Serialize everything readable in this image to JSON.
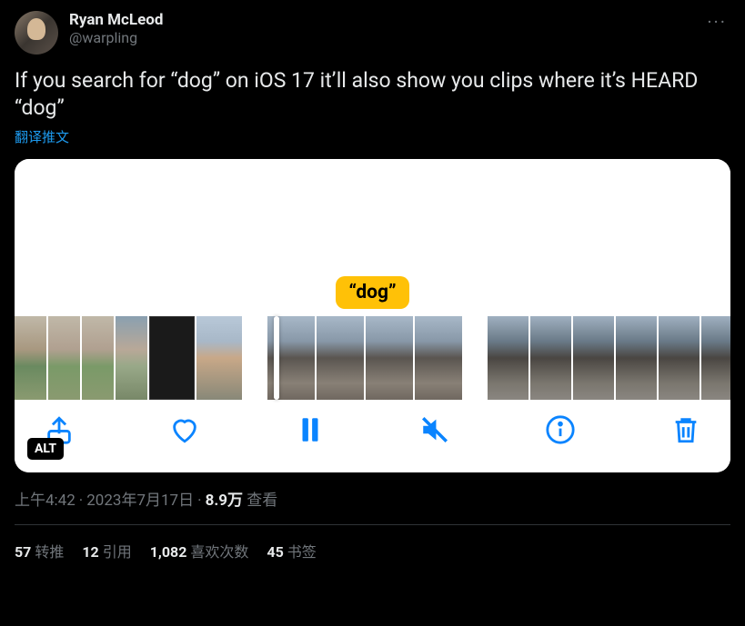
{
  "author": {
    "display_name": "Ryan McLeod",
    "handle": "@warpling"
  },
  "more_label": "···",
  "body": "If you search for “dog” on iOS 17 it’ll also show you clips where it’s HEARD “dog”",
  "translate": "翻译推文",
  "media": {
    "tag": "“dog”",
    "alt_badge": "ALT",
    "icons": {
      "share": "share-icon",
      "like": "heart-icon",
      "pause": "pause-icon",
      "mute": "mute-icon",
      "info": "info-icon",
      "trash": "trash-icon"
    }
  },
  "meta": {
    "time": "上午4:42",
    "date": "2023年7月17日",
    "views_count": "8.9万",
    "views_label": "查看"
  },
  "stats": {
    "retweets": {
      "count": "57",
      "label": "转推"
    },
    "quotes": {
      "count": "12",
      "label": "引用"
    },
    "likes": {
      "count": "1,082",
      "label": "喜欢次数"
    },
    "bookmarks": {
      "count": "45",
      "label": "书签"
    }
  }
}
